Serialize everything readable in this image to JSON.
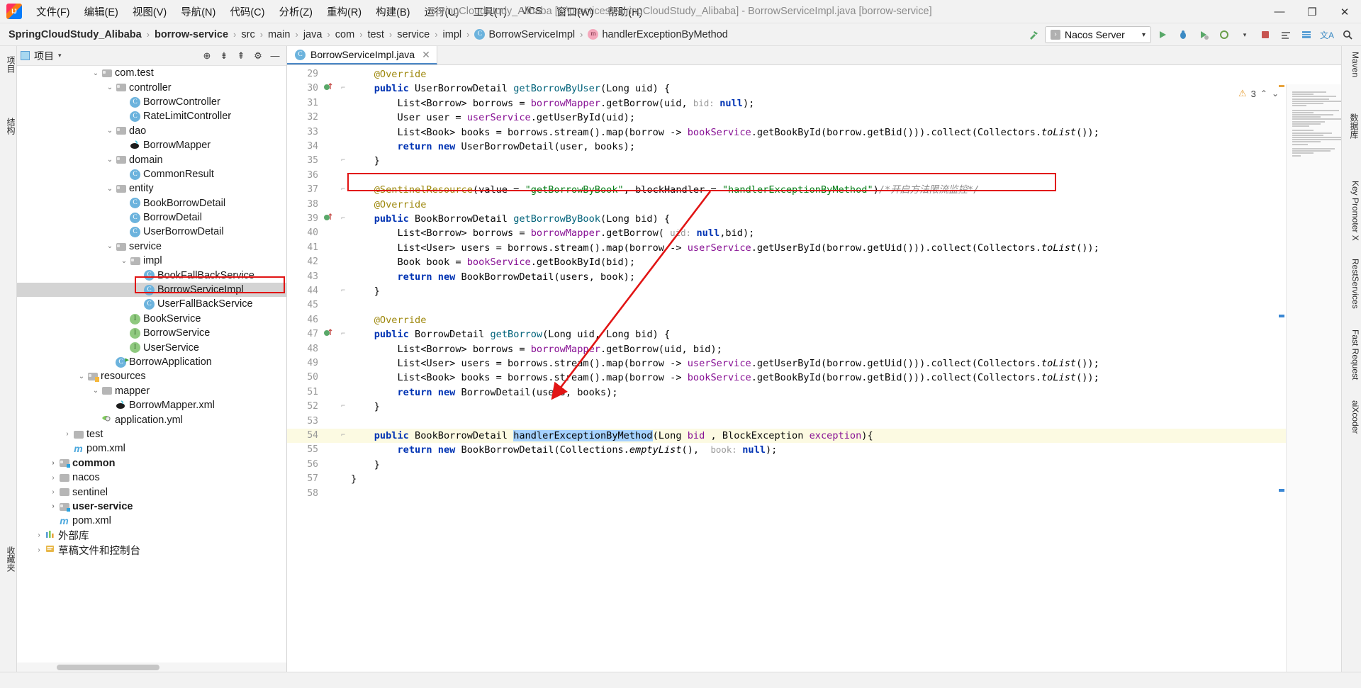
{
  "window": {
    "title": "SpringCloudStudy_Alibaba [...\\practices\\SpringCloudStudy_Alibaba] - BorrowServiceImpl.java [borrow-service]",
    "minimize": "—",
    "maximize": "❐",
    "close": "✕",
    "logo_label": "IJ"
  },
  "menubar": {
    "items": [
      {
        "label": "文件(F)",
        "name": "menu-file"
      },
      {
        "label": "编辑(E)",
        "name": "menu-edit"
      },
      {
        "label": "视图(V)",
        "name": "menu-view"
      },
      {
        "label": "导航(N)",
        "name": "menu-navigate"
      },
      {
        "label": "代码(C)",
        "name": "menu-code"
      },
      {
        "label": "分析(Z)",
        "name": "menu-analyze"
      },
      {
        "label": "重构(R)",
        "name": "menu-refactor"
      },
      {
        "label": "构建(B)",
        "name": "menu-build"
      },
      {
        "label": "运行(U)",
        "name": "menu-run"
      },
      {
        "label": "工具(T)",
        "name": "menu-tools"
      },
      {
        "label": "VCS",
        "name": "menu-vcs"
      },
      {
        "label": "窗口(W)",
        "name": "menu-window"
      },
      {
        "label": "帮助(H)",
        "name": "menu-help"
      }
    ]
  },
  "breadcrumb": {
    "separator": "›",
    "items": [
      {
        "label": "SpringCloudStudy_Alibaba",
        "bold": true,
        "icon": ""
      },
      {
        "label": "borrow-service",
        "bold": true,
        "icon": ""
      },
      {
        "label": "src",
        "bold": false,
        "icon": ""
      },
      {
        "label": "main",
        "bold": false,
        "icon": ""
      },
      {
        "label": "java",
        "bold": false,
        "icon": ""
      },
      {
        "label": "com",
        "bold": false,
        "icon": ""
      },
      {
        "label": "test",
        "bold": false,
        "icon": ""
      },
      {
        "label": "service",
        "bold": false,
        "icon": ""
      },
      {
        "label": "impl",
        "bold": false,
        "icon": ""
      },
      {
        "label": "BorrowServiceImpl",
        "bold": false,
        "icon": "C"
      },
      {
        "label": "handlerExceptionByMethod",
        "bold": false,
        "icon": "m"
      }
    ]
  },
  "toolbar": {
    "build_icon": "hammer-icon",
    "run_config": "Nacos Server",
    "run_config_glyph": "›",
    "dropdown_caret": "▾",
    "run_icon": "▶",
    "debug_icon": "🐞",
    "coverage_icon": "▶",
    "profile_icon": "◉",
    "stop_icon": "■",
    "search_icon": "🔍",
    "translate_icon": "文A",
    "db_icon": "▤",
    "struct_icon": "▥"
  },
  "left_tool_windows": [
    {
      "label": "项目",
      "name": "tool-window-project"
    },
    {
      "label": "结构",
      "name": "tool-window-structure"
    },
    {
      "label": "收藏夹",
      "name": "tool-window-favorites"
    }
  ],
  "right_tool_windows": [
    {
      "label": "Maven",
      "name": "tool-window-maven"
    },
    {
      "label": "数据库",
      "name": "tool-window-database"
    },
    {
      "label": "Key Promoter X",
      "name": "tool-window-key-promoter"
    },
    {
      "label": "RestServices",
      "name": "tool-window-restservices"
    },
    {
      "label": "Fast Request",
      "name": "tool-window-fast-request"
    },
    {
      "label": "aiXcoder",
      "name": "tool-window-aixcoder"
    }
  ],
  "project_panel": {
    "title": "项目",
    "caret": "▾",
    "header_icons": [
      {
        "name": "locate-icon",
        "glyph": "⊕"
      },
      {
        "name": "collapse-all-icon",
        "glyph": "⇟"
      },
      {
        "name": "expand-all-icon",
        "glyph": "⇞"
      },
      {
        "name": "settings-gear-icon",
        "glyph": "⚙"
      },
      {
        "name": "hide-panel-icon",
        "glyph": "—"
      }
    ],
    "tree": [
      {
        "label": "com.test",
        "indent": 5,
        "arrow": "v",
        "icon": "folder",
        "bold": false,
        "selected": false
      },
      {
        "label": "controller",
        "indent": 6,
        "arrow": "v",
        "icon": "folder",
        "bold": false,
        "selected": false
      },
      {
        "label": "BorrowController",
        "indent": 7,
        "arrow": "",
        "icon": "class",
        "bold": false,
        "selected": false
      },
      {
        "label": "RateLimitController",
        "indent": 7,
        "arrow": "",
        "icon": "class",
        "bold": false,
        "selected": false
      },
      {
        "label": "dao",
        "indent": 6,
        "arrow": "v",
        "icon": "folder",
        "bold": false,
        "selected": false
      },
      {
        "label": "BorrowMapper",
        "indent": 7,
        "arrow": "",
        "icon": "mybatis",
        "bold": false,
        "selected": false
      },
      {
        "label": "domain",
        "indent": 6,
        "arrow": "v",
        "icon": "folder",
        "bold": false,
        "selected": false
      },
      {
        "label": "CommonResult",
        "indent": 7,
        "arrow": "",
        "icon": "class",
        "bold": false,
        "selected": false
      },
      {
        "label": "entity",
        "indent": 6,
        "arrow": "v",
        "icon": "folder",
        "bold": false,
        "selected": false
      },
      {
        "label": "BookBorrowDetail",
        "indent": 7,
        "arrow": "",
        "icon": "class",
        "bold": false,
        "selected": false
      },
      {
        "label": "BorrowDetail",
        "indent": 7,
        "arrow": "",
        "icon": "class",
        "bold": false,
        "selected": false
      },
      {
        "label": "UserBorrowDetail",
        "indent": 7,
        "arrow": "",
        "icon": "class",
        "bold": false,
        "selected": false
      },
      {
        "label": "service",
        "indent": 6,
        "arrow": "v",
        "icon": "folder",
        "bold": false,
        "selected": false
      },
      {
        "label": "impl",
        "indent": 7,
        "arrow": "v",
        "icon": "folder",
        "bold": false,
        "selected": false
      },
      {
        "label": "BookFallBackService",
        "indent": 8,
        "arrow": "",
        "icon": "class",
        "bold": false,
        "selected": false
      },
      {
        "label": "BorrowServiceImpl",
        "indent": 8,
        "arrow": "",
        "icon": "class",
        "bold": false,
        "selected": true
      },
      {
        "label": "UserFallBackService",
        "indent": 8,
        "arrow": "",
        "icon": "class",
        "bold": false,
        "selected": false
      },
      {
        "label": "BookService",
        "indent": 7,
        "arrow": "",
        "icon": "interface",
        "bold": false,
        "selected": false
      },
      {
        "label": "BorrowService",
        "indent": 7,
        "arrow": "",
        "icon": "interface",
        "bold": false,
        "selected": false
      },
      {
        "label": "UserService",
        "indent": 7,
        "arrow": "",
        "icon": "interface",
        "bold": false,
        "selected": false
      },
      {
        "label": "BorrowApplication",
        "indent": 6,
        "arrow": "",
        "icon": "runnable",
        "bold": false,
        "selected": false
      },
      {
        "label": "resources",
        "indent": 4,
        "arrow": "v",
        "icon": "res-folder",
        "bold": false,
        "selected": false
      },
      {
        "label": "mapper",
        "indent": 5,
        "arrow": "v",
        "icon": "plain-folder",
        "bold": false,
        "selected": false
      },
      {
        "label": "BorrowMapper.xml",
        "indent": 6,
        "arrow": "",
        "icon": "mybatis",
        "bold": false,
        "selected": false
      },
      {
        "label": "application.yml",
        "indent": 5,
        "arrow": "",
        "icon": "yml",
        "bold": false,
        "selected": false
      },
      {
        "label": "test",
        "indent": 3,
        "arrow": ">",
        "icon": "plain-folder",
        "bold": false,
        "selected": false
      },
      {
        "label": "pom.xml",
        "indent": 3,
        "arrow": "",
        "icon": "maven",
        "bold": false,
        "selected": false
      },
      {
        "label": "common",
        "indent": 2,
        "arrow": ">",
        "icon": "src-folder",
        "bold": true,
        "selected": false
      },
      {
        "label": "nacos",
        "indent": 2,
        "arrow": ">",
        "icon": "plain-folder",
        "bold": false,
        "selected": false
      },
      {
        "label": "sentinel",
        "indent": 2,
        "arrow": ">",
        "icon": "plain-folder",
        "bold": false,
        "selected": false
      },
      {
        "label": "user-service",
        "indent": 2,
        "arrow": ">",
        "icon": "src-folder",
        "bold": true,
        "selected": false
      },
      {
        "label": "pom.xml",
        "indent": 2,
        "arrow": "",
        "icon": "maven",
        "bold": false,
        "selected": false
      },
      {
        "label": "外部库",
        "indent": 1,
        "arrow": ">",
        "icon": "library",
        "bold": false,
        "selected": false
      },
      {
        "label": "草稿文件和控制台",
        "indent": 1,
        "arrow": ">",
        "icon": "scratch",
        "bold": false,
        "selected": false
      }
    ]
  },
  "editor": {
    "tab": {
      "label": "BorrowServiceImpl.java",
      "icon": "C",
      "close": "✕"
    },
    "inspection": {
      "warn_glyph": "⚠",
      "warn_count": "3",
      "up": "⌃",
      "down": "⌄"
    },
    "first_line": 29,
    "lines": [
      {
        "n": 29,
        "gutter": "",
        "fold": "",
        "html": "    <span class='ann'>@Override</span>"
      },
      {
        "n": 30,
        "gutter": "impl",
        "fold": "−",
        "html": "    <span class='kw'>public</span> <span class='plain'>UserBorrowDetail</span> <span class='mth'>getBorrowByUser</span><span class='plain'>(Long uid) {</span>"
      },
      {
        "n": 31,
        "gutter": "",
        "fold": "",
        "html": "        <span class='plain'>List&lt;Borrow&gt; borrows = </span><span class='fld'>borrowMapper</span><span class='plain'>.</span><span class='plain'>getBorrow(uid, </span><span class='hint'>bid: </span><span class='kw'>null</span><span class='plain'>);</span>"
      },
      {
        "n": 32,
        "gutter": "",
        "fold": "",
        "html": "        <span class='plain'>User user = </span><span class='fld'>userService</span><span class='plain'>.getUserById(uid);</span>"
      },
      {
        "n": 33,
        "gutter": "",
        "fold": "",
        "html": "        <span class='plain'>List&lt;Book&gt; books = borrows.stream().map(borrow -&gt; </span><span class='fld'>bookService</span><span class='plain'>.getBookById(borrow.getBid())).collect(Collectors.</span><span class='ital'>toList</span><span class='plain'>());</span>"
      },
      {
        "n": 34,
        "gutter": "",
        "fold": "",
        "html": "        <span class='kw'>return</span> <span class='kw'>new</span> <span class='plain'>UserBorrowDetail(user, books);</span>"
      },
      {
        "n": 35,
        "gutter": "",
        "fold": "−",
        "html": "    <span class='plain'>}</span>"
      },
      {
        "n": 36,
        "gutter": "",
        "fold": "",
        "html": ""
      },
      {
        "n": 37,
        "gutter": "",
        "fold": "−",
        "html": "    <span class='ann'>@SentinelResource</span><span class='plain'>(value = </span><span class='str'>\"getBorrowByBook\"</span><span class='plain'>, blockHandler = </span><span class='str'>\"handlerExceptionByMethod\"</span><span class='plain'>)</span><span class='cmt'>/*开启方法限流监控*/</span>"
      },
      {
        "n": 38,
        "gutter": "",
        "fold": "",
        "html": "    <span class='ann'>@Override</span>"
      },
      {
        "n": 39,
        "gutter": "impl",
        "fold": "−",
        "html": "    <span class='kw'>public</span> <span class='plain'>BookBorrowDetail</span> <span class='mth'>getBorrowByBook</span><span class='plain'>(Long bid) {</span>"
      },
      {
        "n": 40,
        "gutter": "",
        "fold": "",
        "html": "        <span class='plain'>List&lt;Borrow&gt; borrows = </span><span class='fld'>borrowMapper</span><span class='plain'>.getBorrow( </span><span class='hint'>uid: </span><span class='kw'>null</span><span class='plain'>,bid);</span>"
      },
      {
        "n": 41,
        "gutter": "",
        "fold": "",
        "html": "        <span class='plain'>List&lt;User&gt; users = borrows.stream().map(borrow -&gt; </span><span class='fld'>userService</span><span class='plain'>.getUserById(borrow.getUid())).collect(Collectors.</span><span class='ital'>toList</span><span class='plain'>());</span>"
      },
      {
        "n": 42,
        "gutter": "",
        "fold": "",
        "html": "        <span class='plain'>Book book = </span><span class='fld'>bookService</span><span class='plain'>.getBookById(bid);</span>"
      },
      {
        "n": 43,
        "gutter": "",
        "fold": "",
        "html": "        <span class='kw'>return</span> <span class='kw'>new</span> <span class='plain'>BookBorrowDetail(users, book);</span>"
      },
      {
        "n": 44,
        "gutter": "",
        "fold": "−",
        "html": "    <span class='plain'>}</span>"
      },
      {
        "n": 45,
        "gutter": "",
        "fold": "",
        "html": ""
      },
      {
        "n": 46,
        "gutter": "",
        "fold": "",
        "html": "    <span class='ann'>@Override</span>"
      },
      {
        "n": 47,
        "gutter": "impl",
        "fold": "−",
        "html": "    <span class='kw'>public</span> <span class='plain'>BorrowDetail</span> <span class='mth'>getBorrow</span><span class='plain'>(Long uid, Long bid) {</span>"
      },
      {
        "n": 48,
        "gutter": "",
        "fold": "",
        "html": "        <span class='plain'>List&lt;Borrow&gt; borrows = </span><span class='fld'>borrowMapper</span><span class='plain'>.getBorrow(uid, bid);</span>"
      },
      {
        "n": 49,
        "gutter": "",
        "fold": "",
        "html": "        <span class='plain'>List&lt;User&gt; users = borrows.stream().map(borrow -&gt; </span><span class='fld'>userService</span><span class='plain'>.getUserById(borrow.getUid())).collect(Collectors.</span><span class='ital'>toList</span><span class='plain'>());</span>"
      },
      {
        "n": 50,
        "gutter": "",
        "fold": "",
        "html": "        <span class='plain'>List&lt;Book&gt; books = borrows.stream().map(borrow -&gt; </span><span class='fld'>bookService</span><span class='plain'>.getBookById(borrow.getBid())).collect(Collectors.</span><span class='ital'>toList</span><span class='plain'>());</span>"
      },
      {
        "n": 51,
        "gutter": "",
        "fold": "",
        "html": "        <span class='kw'>return</span> <span class='kw'>new</span> <span class='plain'>BorrowDetail(users, books);</span>"
      },
      {
        "n": 52,
        "gutter": "",
        "fold": "−",
        "html": "    <span class='plain'>}</span>"
      },
      {
        "n": 53,
        "gutter": "",
        "fold": "",
        "html": ""
      },
      {
        "n": 54,
        "gutter": "",
        "fold": "−",
        "html": "    <span class='kw'>public</span> <span class='plain'>BookBorrowDetail </span><span class='selhl'>handlerExceptionByMethod</span><span class='plain'>(Long </span><span class='fld'>bid</span><span class='plain'> , BlockException </span><span class='fld'>exception</span><span class='plain'>){</span>",
        "highlight": true
      },
      {
        "n": 55,
        "gutter": "",
        "fold": "",
        "html": "        <span class='kw'>return</span> <span class='kw'>new</span> <span class='plain'>BookBorrowDetail(Collections.</span><span class='ital'>emptyList</span><span class='plain'>(),  </span><span class='hint'>book: </span><span class='kw'>null</span><span class='plain'>);</span>"
      },
      {
        "n": 56,
        "gutter": "",
        "fold": "",
        "html": "    <span class='plain'>}</span>"
      },
      {
        "n": 57,
        "gutter": "",
        "fold": "",
        "html": "<span class='plain'>}</span>"
      },
      {
        "n": 58,
        "gutter": "",
        "fold": "",
        "html": ""
      }
    ],
    "annotations": {
      "box_sentinel": {
        "name": "red-box-sentinel-annotation"
      },
      "box_method": {
        "name": "red-box-handler-method"
      },
      "box_tree": {
        "name": "red-box-tree-selection"
      },
      "arrow": {
        "name": "red-arrow-annotation",
        "color": "#e11414"
      }
    }
  },
  "colors": {
    "accent": "#4a87c7",
    "annotation_red": "#e11414",
    "keyword": "#0033b3",
    "string": "#067d17",
    "field": "#871094",
    "annotation": "#9e880d",
    "method": "#00627a",
    "comment": "#8c8c8c",
    "selection": "#a6d2ff",
    "line_highlight": "#fcfae2"
  }
}
